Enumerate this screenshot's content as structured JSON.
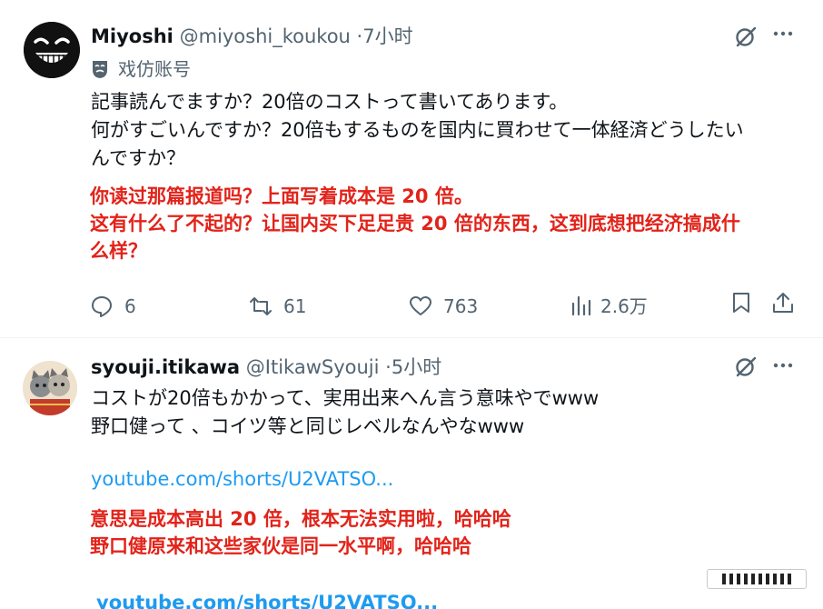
{
  "tweets": [
    {
      "display_name": "Miyoshi",
      "handle": "@miyoshi_koukou",
      "separator": "·",
      "time": "7小时",
      "badge_label": "戏仿账号",
      "text_lines": [
        "記事読んでますか？20倍のコストって書いてあります。",
        "何がすごいんですか？20倍もするものを国内に買わせて一体経済どうしたい",
        "んですか？"
      ],
      "translation_lines": [
        "你读过那篇报道吗？上面写着成本是 20 倍。",
        "这有什么了不起的？让国内买下足足贵 20 倍的东西，这到底想把经济搞成什",
        "么样？"
      ],
      "stats": {
        "replies": "6",
        "reposts": "61",
        "likes": "763",
        "views": "2.6万"
      }
    },
    {
      "display_name": "syouji.itikawa",
      "handle": "@ItikawSyouji",
      "separator": "·",
      "time": "5小时",
      "text_lines": [
        "コストが20倍もかかって、実用出来へん言う意味やでwww",
        "野口健って 、コイツ等と同じレベルなんやなwww"
      ],
      "link": "youtube.com/shorts/U2VATSO...",
      "translation_lines": [
        "意思是成本高出 20 倍，根本无法实用啦，哈哈哈",
        "野口健原来和这些家伙是同一水平啊，哈哈哈"
      ],
      "link2": "youtube.com/shorts/U2VATSO..."
    }
  ],
  "colors": {
    "text": "#0f1419",
    "muted": "#536471",
    "link": "#1d9bf0",
    "translation": "#e2231a"
  },
  "icons": [
    "grok-icon",
    "more-icon",
    "parody-mask-icon",
    "reply-icon",
    "repost-icon",
    "like-icon",
    "views-icon",
    "bookmark-icon",
    "share-icon"
  ]
}
